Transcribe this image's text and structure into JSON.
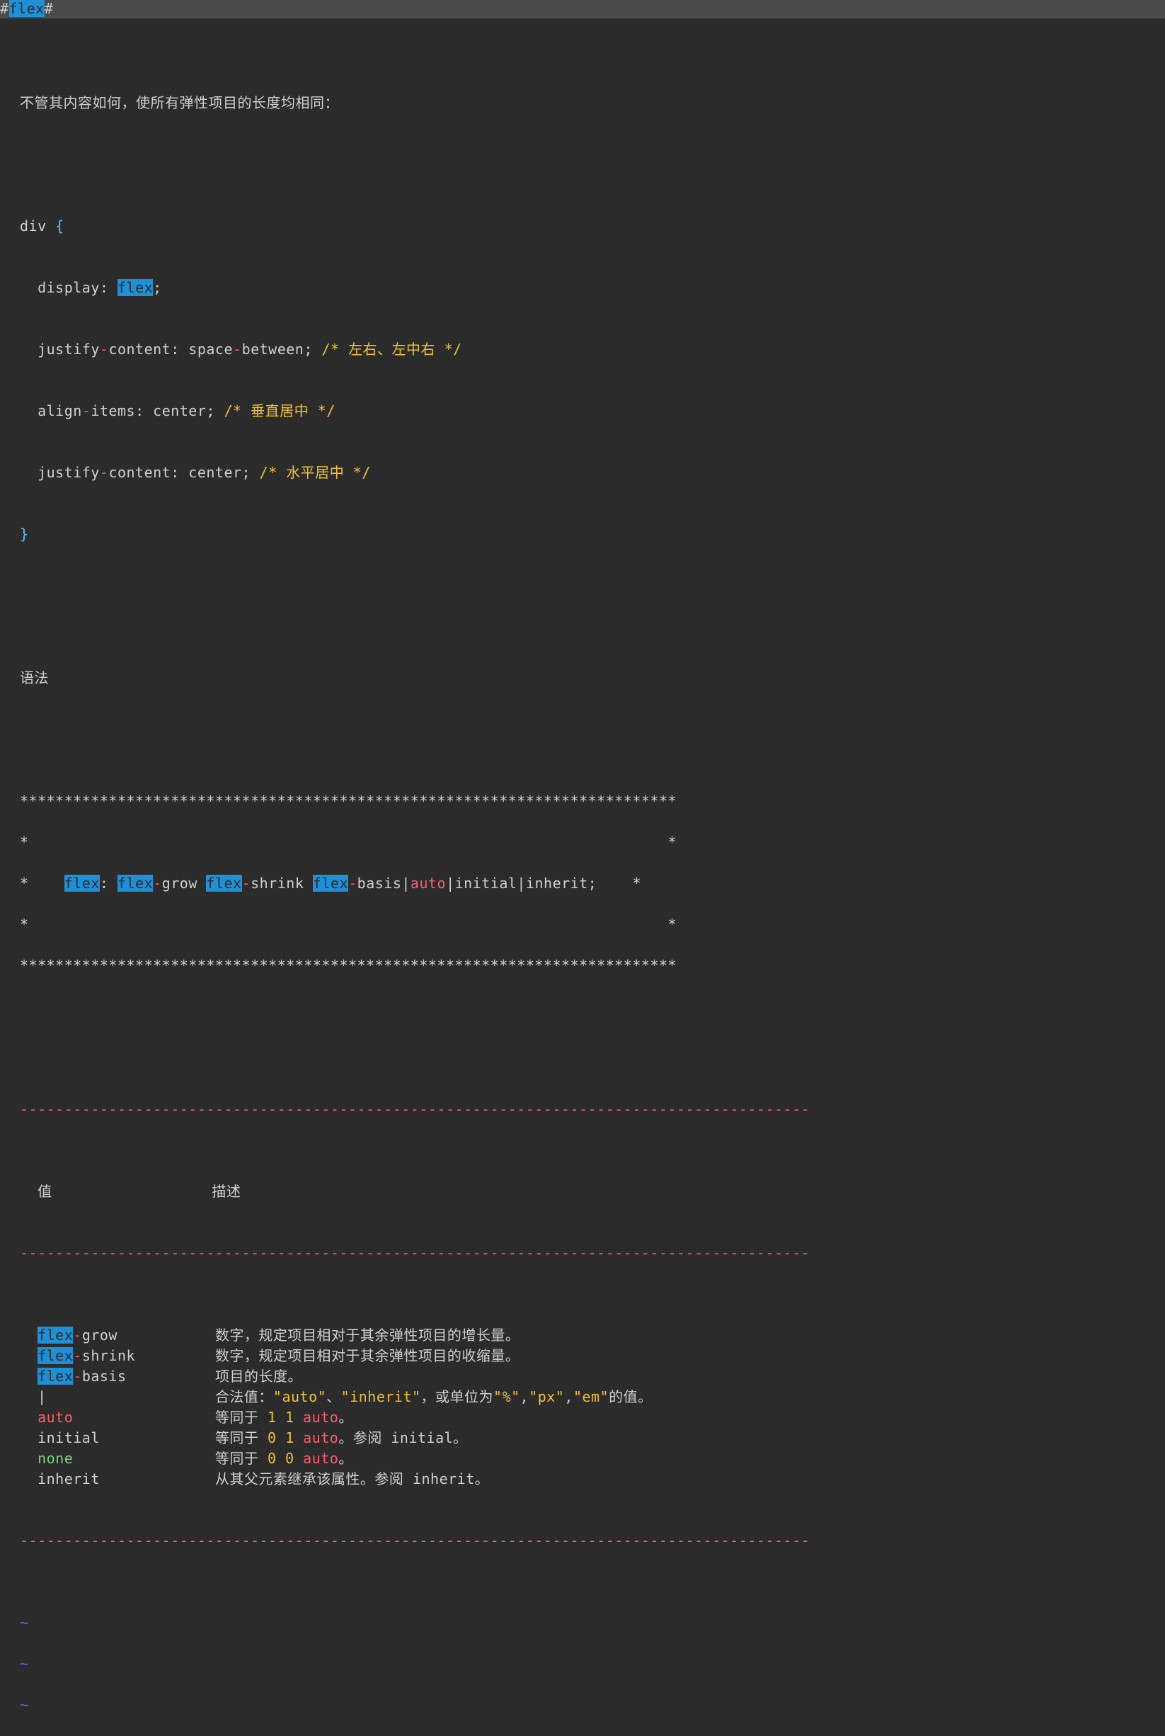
{
  "title": {
    "hash1": "#",
    "highlighted": "flex",
    "hash2": "#"
  },
  "intro": "不管其内容如何，使所有弹性项目的长度均相同：",
  "css_block": {
    "selector": "div ",
    "open": "{",
    "lines": [
      {
        "prop": "display",
        "colon": ": ",
        "value_hl": "flex",
        "after": ";"
      },
      {
        "prop_a": "justify",
        "dash": "-",
        "prop_b": "content: space",
        "dash2": "-",
        "prop_c": "between; ",
        "comment": "/* 左右、左中右 */"
      },
      {
        "prop_a": "align",
        "dash": "-",
        "prop_b": "items: center; ",
        "comment": "/* 垂直居中 */"
      },
      {
        "prop_a": "justify",
        "dash": "-",
        "prop_b": "content: center; ",
        "comment": "/* 水平居中 */"
      }
    ],
    "close": "}"
  },
  "syntax_heading": "语法",
  "box": {
    "star_line": "**************************************************************************",
    "pad_line_a": "*                                                                        *",
    "syntax": {
      "lead": "*    ",
      "flex1": "flex",
      "colon": ": ",
      "flex2": "flex",
      "dash1": "-",
      "grow": "grow ",
      "flex3": "flex",
      "dash2": "-",
      "shrink": "shrink ",
      "flex4": "flex",
      "dash3": "-",
      "tail1": "basis|",
      "auto": "auto",
      "tail2": "|initial|inherit;    *"
    },
    "pad_line_b": "*                                                                        *"
  },
  "dash_rule": "-----------------------------------------------------------------------------------------",
  "table": {
    "head_col1": "值",
    "head_col2": "描述",
    "rows": [
      {
        "c1_hl": "flex",
        "c1_dash": "-",
        "c1_rest": "grow",
        "c2_pre": "数字，规定项目相对于其余弹性项目的增长量。"
      },
      {
        "c1_hl": "flex",
        "c1_dash": "-",
        "c1_rest": "shrink",
        "c2_pre": "数字，规定项目相对于其余弹性项目的收缩量。"
      },
      {
        "c1_hl": "flex",
        "c1_dash": "-",
        "c1_rest": "basis",
        "c2_pre": "项目的长度。"
      },
      {
        "c1_plain": "|",
        "c2_seg1": "合法值：",
        "c2_str1": "\"auto\"",
        "c2_seg2": "、",
        "c2_str2": "\"inherit\"",
        "c2_seg3": "，或单位为",
        "c2_str3": "\"%\"",
        "c2_seg4": ",",
        "c2_str4": "\"px\"",
        "c2_seg5": ",",
        "c2_str5": "\"em\"",
        "c2_seg6": "的值。"
      },
      {
        "c1_auto": "auto",
        "c2_pre": "等同于 ",
        "c2_num": "1 1 ",
        "c2_auto": "auto",
        "c2_post": "。"
      },
      {
        "c1_plain": "initial",
        "c2_pre": "等同于 ",
        "c2_num": "0 1 ",
        "c2_auto": "auto",
        "c2_post": "。参阅 initial。"
      },
      {
        "c1_none": "none",
        "c2_pre": "等同于 ",
        "c2_num": "0 0 ",
        "c2_auto": "auto",
        "c2_post": "。"
      },
      {
        "c1_plain": "inherit",
        "c2_pre": "从其父元素继承该属性。参阅 inherit。"
      }
    ]
  },
  "tilde": "~",
  "col1_width": 20,
  "indent2": "  "
}
